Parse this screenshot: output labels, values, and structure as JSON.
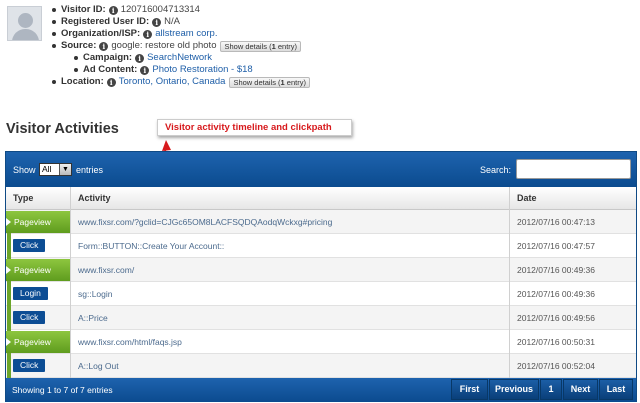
{
  "visitor": {
    "visitor_id_label": "Visitor ID:",
    "visitor_id": "120716004713314",
    "registered_label": "Registered User ID:",
    "registered_value": "N/A",
    "org_label": "Organization/ISP:",
    "org_value": "allstream corp.",
    "source_label": "Source:",
    "source_value": "google: restore old photo",
    "campaign_label": "Campaign:",
    "campaign_value": "SearchNetwork",
    "ad_label": "Ad Content:",
    "ad_value": "Photo Restoration - $18",
    "location_label": "Location:",
    "location_value": "Toronto, Ontario, Canada",
    "details_prefix": "Show details (",
    "details_count": "1",
    "details_suffix": " entry)",
    "info_glyph": "i"
  },
  "section_title": "Visitor Activities",
  "annotation": "Visitor activity timeline and clickpath",
  "table": {
    "show_label": "Show",
    "entries_label": "entries",
    "length_value": "All",
    "dropdown_glyph": "▼",
    "search_label": "Search:",
    "columns": {
      "type": "Type",
      "activity": "Activity",
      "date": "Date"
    },
    "rows": [
      {
        "type": "Pageview",
        "activity": "www.fixsr.com/?gclid=CJGc65OM8LACFSQDQAodqWckxg#pricing",
        "date": "2012/07/16 00:47:13"
      },
      {
        "type": "Click",
        "activity": "Form::BUTTON::Create Your Account::",
        "date": "2012/07/16 00:47:57"
      },
      {
        "type": "Pageview",
        "activity": "www.fixsr.com/",
        "date": "2012/07/16 00:49:36"
      },
      {
        "type": "Login",
        "activity": "sg::Login",
        "date": "2012/07/16 00:49:36"
      },
      {
        "type": "Click",
        "activity": "A::Price",
        "date": "2012/07/16 00:49:56"
      },
      {
        "type": "Pageview",
        "activity": "www.fixsr.com/html/faqs.jsp",
        "date": "2012/07/16 00:50:31"
      },
      {
        "type": "Click",
        "activity": "A::Log Out",
        "date": "2012/07/16 00:52:04"
      }
    ],
    "info": "Showing 1 to 7 of 7 entries",
    "pagination": {
      "first": "First",
      "previous": "Previous",
      "page": "1",
      "next": "Next",
      "last": "Last"
    }
  },
  "colors": {
    "panel_blue": "#0b4b8f",
    "pageview_green": "#6ba52a",
    "badge_blue": "#0c4d94",
    "annotation_red": "#d7191c",
    "link_blue": "#1f5fa8"
  }
}
